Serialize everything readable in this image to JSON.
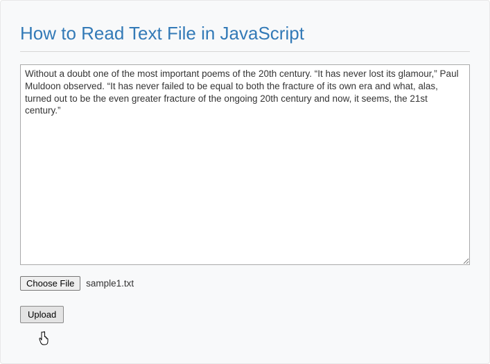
{
  "title": "How to Read Text File in JavaScript",
  "textarea_value": "Without a doubt one of the most important poems of the 20th century. “It has never lost its glamour,” Paul Muldoon observed. “It has never failed to be equal to both the fracture of its own era and what, alas, turned out to be the even greater fracture of the ongoing 20th century and now, it seems, the 21st century.”",
  "file_input": {
    "button_label": "Choose File",
    "selected_file": "sample1.txt"
  },
  "upload_label": "Upload"
}
